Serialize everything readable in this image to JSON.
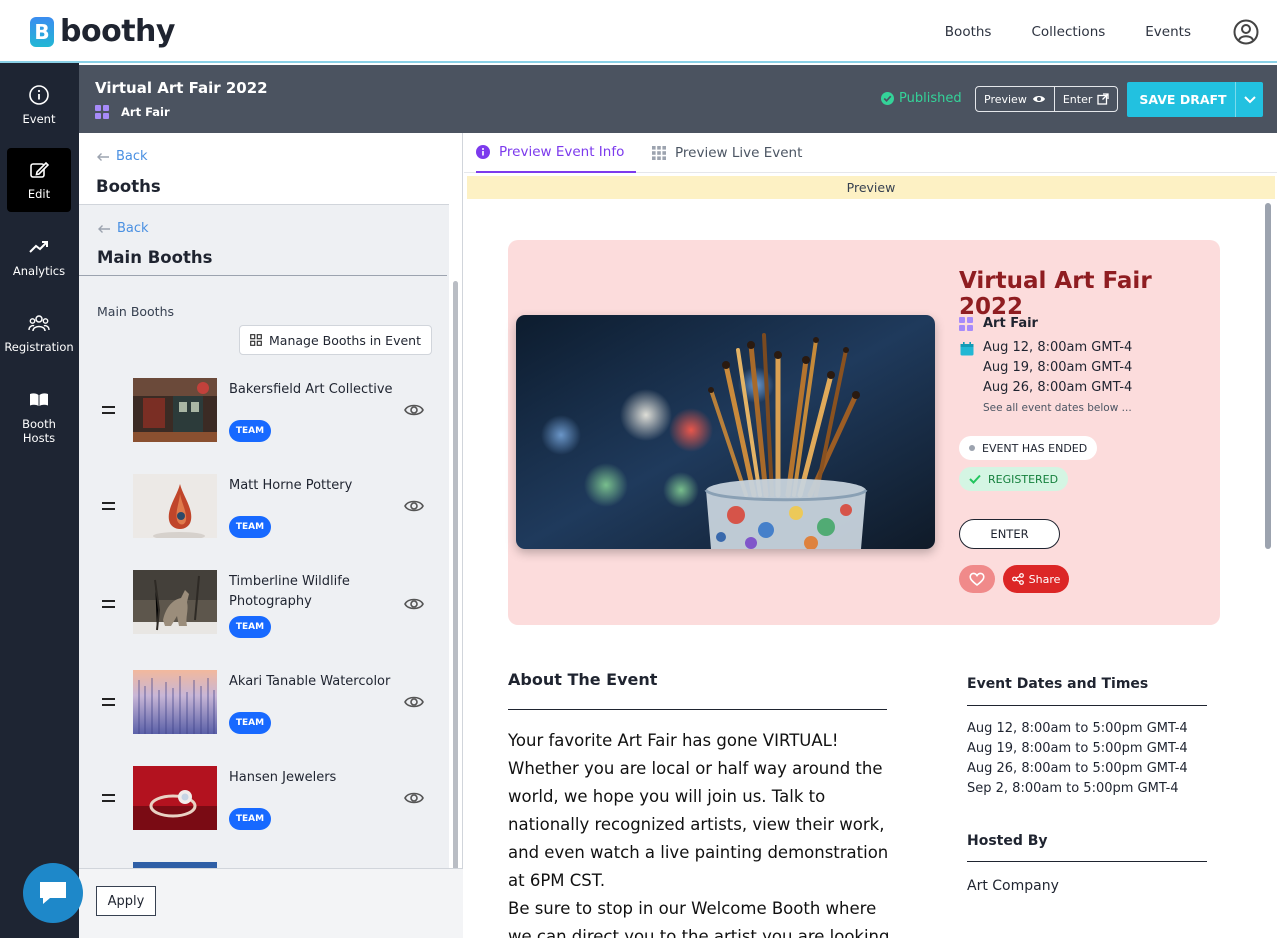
{
  "app": {
    "logo_letter": "B",
    "logo_text": "boothy"
  },
  "topnav": {
    "items": [
      "Booths",
      "Collections",
      "Events"
    ]
  },
  "leftnav": {
    "items": [
      {
        "label": "Event",
        "icon": "info-icon"
      },
      {
        "label": "Edit",
        "icon": "edit-icon",
        "active": true
      },
      {
        "label": "Analytics",
        "icon": "trending-up-icon"
      },
      {
        "label": "Registration",
        "icon": "people-icon"
      },
      {
        "label": "Booth Hosts",
        "icon": "book-icon"
      }
    ]
  },
  "event_header": {
    "title": "Virtual Art Fair 2022",
    "category": "Art Fair",
    "status": "Published",
    "preview_label": "Preview",
    "enter_label": "Enter",
    "save_label": "SAVE DRAFT"
  },
  "booths_panel": {
    "back_label": "Back",
    "title": "Booths",
    "sub_back_label": "Back",
    "sub_title": "Main Booths",
    "section_label": "Main Booths",
    "manage_label": "Manage Booths in Event",
    "apply_label": "Apply",
    "booths": [
      {
        "name": "Bakersfield Art Collective",
        "badge": "TEAM"
      },
      {
        "name": "Matt Horne Pottery",
        "badge": "TEAM"
      },
      {
        "name": "Timberline Wildlife Photography",
        "badge": "TEAM"
      },
      {
        "name": "Akari Tanable Watercolor",
        "badge": "TEAM"
      },
      {
        "name": "Hansen Jewelers",
        "badge": "TEAM"
      }
    ]
  },
  "preview": {
    "tabs": [
      "Preview Event Info",
      "Preview Live Event"
    ],
    "strip_label": "Preview",
    "title": "Virtual Art Fair 2022",
    "category": "Art Fair",
    "dates": [
      "Aug 12, 8:00am GMT-4",
      "Aug 19, 8:00am GMT-4",
      "Aug 26, 8:00am GMT-4"
    ],
    "see_all": "See all event dates below ...",
    "ended_chip": "EVENT HAS ENDED",
    "registered_chip": "REGISTERED",
    "enter_label": "ENTER",
    "share_label": "Share",
    "about_heading": "About The Event",
    "about_p1": "Your favorite Art Fair has gone VIRTUAL! Whether you are local or half way around the world, we hope you will join us. Talk to nationally recognized artists, view their work, and even watch a live painting demonstration at 6PM CST.",
    "about_p2": "Be sure to stop in our Welcome Booth where we can direct you to the artist you are looking for.",
    "dates_heading": "Event Dates and Times",
    "full_dates": [
      "Aug 12, 8:00am to 5:00pm GMT-4",
      "Aug 19, 8:00am to 5:00pm GMT-4",
      "Aug 26, 8:00am to 5:00pm GMT-4",
      "Sep 2, 8:00am to 5:00pm GMT-4"
    ],
    "hosted_heading": "Hosted By",
    "host": "Art Company"
  },
  "colors": {
    "accent": "#22c1e0",
    "nav_bg": "#1e2533",
    "title_red": "#8f1d21",
    "hero_bg": "#fcdcdc",
    "published_green": "#34d399",
    "tab_purple": "#7c3aed",
    "team_blue": "#1769ff"
  }
}
